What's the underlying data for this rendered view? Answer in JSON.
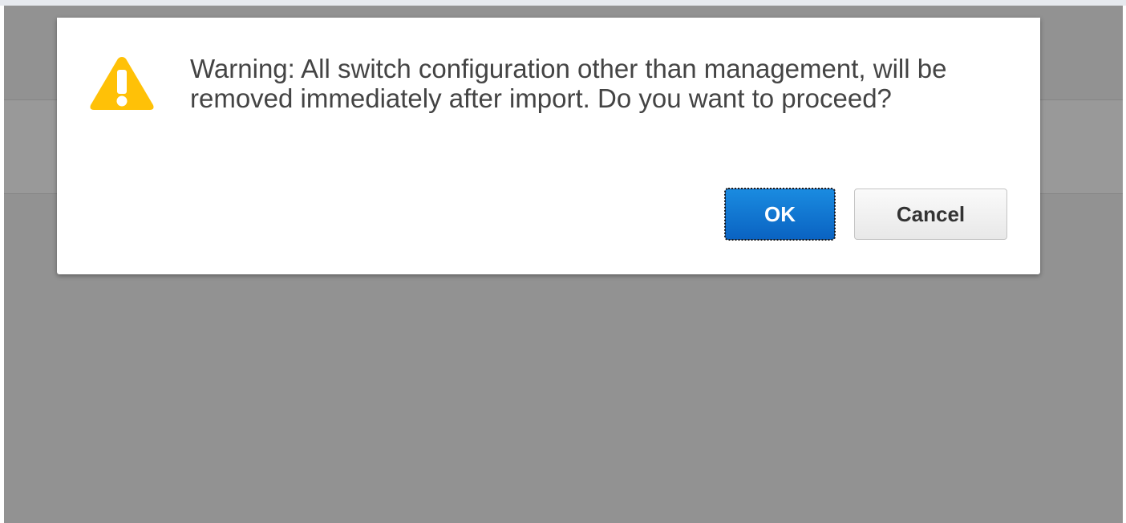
{
  "dialog": {
    "message": "Warning: All switch configuration other than management, will be removed immediately after import. Do you want to proceed?",
    "icon": "warning-triangle-icon",
    "ok_label": "OK",
    "cancel_label": "Cancel"
  },
  "colors": {
    "overlay": "#929292",
    "topbar": "#e6e9ee",
    "warning_icon": "#ffc107",
    "ok_button": "#0a6fd1",
    "text": "#444444"
  }
}
